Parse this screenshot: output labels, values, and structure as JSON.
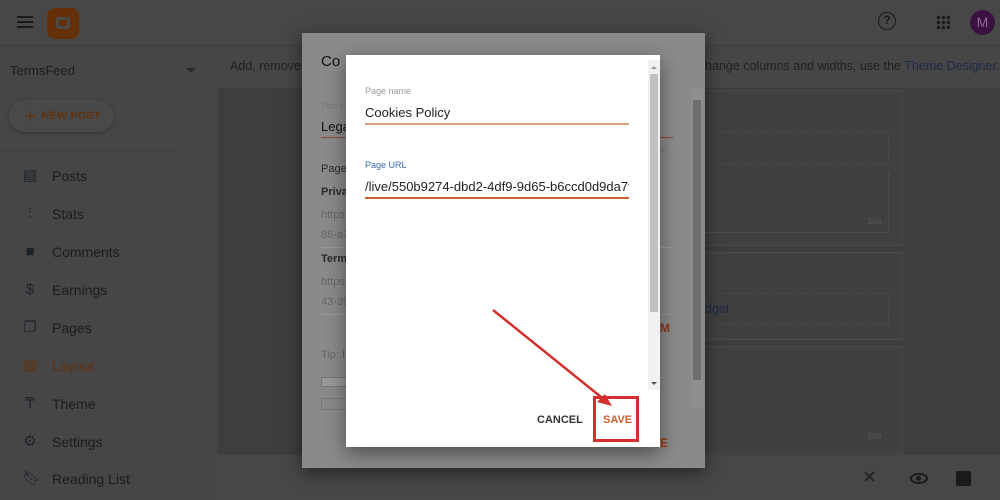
{
  "header": {
    "blog_name": "TermsFeed",
    "avatar_letter": "M",
    "icons": [
      "menu-icon",
      "blogger-logo",
      "help-icon",
      "apps-icon"
    ]
  },
  "sidebar": {
    "new_post": "NEW POST",
    "items": [
      {
        "label": "Posts",
        "icon": "posts-icon"
      },
      {
        "label": "Stats",
        "icon": "stats-icon"
      },
      {
        "label": "Comments",
        "icon": "comments-icon"
      },
      {
        "label": "Earnings",
        "icon": "dollar-icon"
      },
      {
        "label": "Pages",
        "icon": "pages-icon"
      },
      {
        "label": "Layout",
        "icon": "layout-icon",
        "active": true
      },
      {
        "label": "Theme",
        "icon": "paint-roller-icon"
      },
      {
        "label": "Settings",
        "icon": "gear-icon"
      },
      {
        "label": "Reading List",
        "icon": "bookmark-icon"
      }
    ]
  },
  "main": {
    "intro_start": "Add, remove",
    "intro_end": "hange columns and widths, use the",
    "theme_designer_link": "Theme Designer",
    "intro_tail": ".",
    "edit": "Edit",
    "gadget_fragment": "dget"
  },
  "config_dialog": {
    "title_fragment": "Co",
    "title_label_fragment": "Title (",
    "title_value_fragment": "Lega",
    "count_fragment": "00",
    "pages_fragment": "Page",
    "privacy_fragment": "Priva",
    "url1a": "https",
    "url1b": "86-a7",
    "terms_fragment": "Term",
    "url2a": "https",
    "url2b": "43-39",
    "tip_fragment": "Tip: I",
    "add_fragment": "M",
    "save_fragment": "VE"
  },
  "page_dialog": {
    "page_name_label": "Page name",
    "page_name_value": "Cookies Policy",
    "page_url_label": "Page URL",
    "page_url_value": "/live/550b9274-dbd2-4df9-9d65-b6ccd0d9da7f",
    "cancel": "CANCEL",
    "save": "SAVE"
  },
  "colors": {
    "accent": "#c9602f",
    "link": "#2a4f8a",
    "annotation": "#d32f2f"
  }
}
